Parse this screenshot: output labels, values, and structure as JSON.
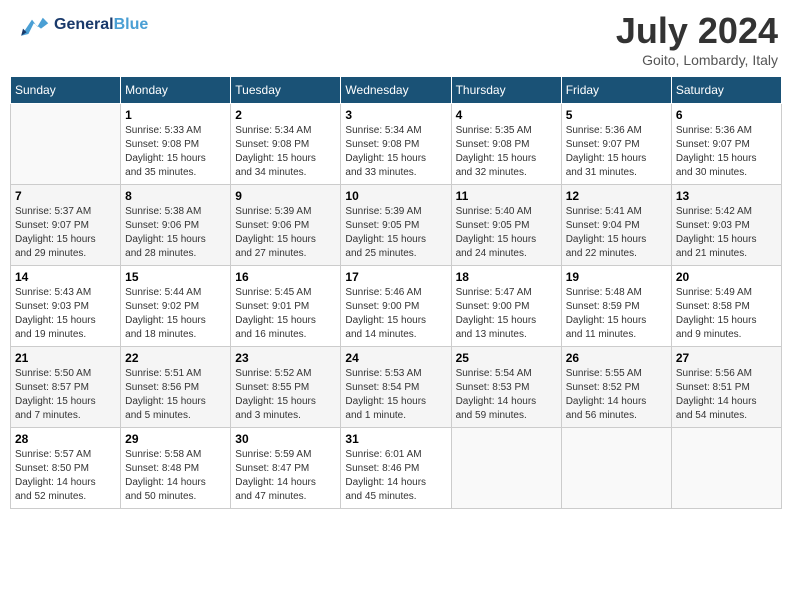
{
  "header": {
    "logo_general": "General",
    "logo_blue": "Blue",
    "title": "July 2024",
    "subtitle": "Goito, Lombardy, Italy"
  },
  "columns": [
    "Sunday",
    "Monday",
    "Tuesday",
    "Wednesday",
    "Thursday",
    "Friday",
    "Saturday"
  ],
  "weeks": [
    [
      {
        "day": "",
        "info": ""
      },
      {
        "day": "1",
        "info": "Sunrise: 5:33 AM\nSunset: 9:08 PM\nDaylight: 15 hours\nand 35 minutes."
      },
      {
        "day": "2",
        "info": "Sunrise: 5:34 AM\nSunset: 9:08 PM\nDaylight: 15 hours\nand 34 minutes."
      },
      {
        "day": "3",
        "info": "Sunrise: 5:34 AM\nSunset: 9:08 PM\nDaylight: 15 hours\nand 33 minutes."
      },
      {
        "day": "4",
        "info": "Sunrise: 5:35 AM\nSunset: 9:08 PM\nDaylight: 15 hours\nand 32 minutes."
      },
      {
        "day": "5",
        "info": "Sunrise: 5:36 AM\nSunset: 9:07 PM\nDaylight: 15 hours\nand 31 minutes."
      },
      {
        "day": "6",
        "info": "Sunrise: 5:36 AM\nSunset: 9:07 PM\nDaylight: 15 hours\nand 30 minutes."
      }
    ],
    [
      {
        "day": "7",
        "info": "Sunrise: 5:37 AM\nSunset: 9:07 PM\nDaylight: 15 hours\nand 29 minutes."
      },
      {
        "day": "8",
        "info": "Sunrise: 5:38 AM\nSunset: 9:06 PM\nDaylight: 15 hours\nand 28 minutes."
      },
      {
        "day": "9",
        "info": "Sunrise: 5:39 AM\nSunset: 9:06 PM\nDaylight: 15 hours\nand 27 minutes."
      },
      {
        "day": "10",
        "info": "Sunrise: 5:39 AM\nSunset: 9:05 PM\nDaylight: 15 hours\nand 25 minutes."
      },
      {
        "day": "11",
        "info": "Sunrise: 5:40 AM\nSunset: 9:05 PM\nDaylight: 15 hours\nand 24 minutes."
      },
      {
        "day": "12",
        "info": "Sunrise: 5:41 AM\nSunset: 9:04 PM\nDaylight: 15 hours\nand 22 minutes."
      },
      {
        "day": "13",
        "info": "Sunrise: 5:42 AM\nSunset: 9:03 PM\nDaylight: 15 hours\nand 21 minutes."
      }
    ],
    [
      {
        "day": "14",
        "info": "Sunrise: 5:43 AM\nSunset: 9:03 PM\nDaylight: 15 hours\nand 19 minutes."
      },
      {
        "day": "15",
        "info": "Sunrise: 5:44 AM\nSunset: 9:02 PM\nDaylight: 15 hours\nand 18 minutes."
      },
      {
        "day": "16",
        "info": "Sunrise: 5:45 AM\nSunset: 9:01 PM\nDaylight: 15 hours\nand 16 minutes."
      },
      {
        "day": "17",
        "info": "Sunrise: 5:46 AM\nSunset: 9:00 PM\nDaylight: 15 hours\nand 14 minutes."
      },
      {
        "day": "18",
        "info": "Sunrise: 5:47 AM\nSunset: 9:00 PM\nDaylight: 15 hours\nand 13 minutes."
      },
      {
        "day": "19",
        "info": "Sunrise: 5:48 AM\nSunset: 8:59 PM\nDaylight: 15 hours\nand 11 minutes."
      },
      {
        "day": "20",
        "info": "Sunrise: 5:49 AM\nSunset: 8:58 PM\nDaylight: 15 hours\nand 9 minutes."
      }
    ],
    [
      {
        "day": "21",
        "info": "Sunrise: 5:50 AM\nSunset: 8:57 PM\nDaylight: 15 hours\nand 7 minutes."
      },
      {
        "day": "22",
        "info": "Sunrise: 5:51 AM\nSunset: 8:56 PM\nDaylight: 15 hours\nand 5 minutes."
      },
      {
        "day": "23",
        "info": "Sunrise: 5:52 AM\nSunset: 8:55 PM\nDaylight: 15 hours\nand 3 minutes."
      },
      {
        "day": "24",
        "info": "Sunrise: 5:53 AM\nSunset: 8:54 PM\nDaylight: 15 hours\nand 1 minute."
      },
      {
        "day": "25",
        "info": "Sunrise: 5:54 AM\nSunset: 8:53 PM\nDaylight: 14 hours\nand 59 minutes."
      },
      {
        "day": "26",
        "info": "Sunrise: 5:55 AM\nSunset: 8:52 PM\nDaylight: 14 hours\nand 56 minutes."
      },
      {
        "day": "27",
        "info": "Sunrise: 5:56 AM\nSunset: 8:51 PM\nDaylight: 14 hours\nand 54 minutes."
      }
    ],
    [
      {
        "day": "28",
        "info": "Sunrise: 5:57 AM\nSunset: 8:50 PM\nDaylight: 14 hours\nand 52 minutes."
      },
      {
        "day": "29",
        "info": "Sunrise: 5:58 AM\nSunset: 8:48 PM\nDaylight: 14 hours\nand 50 minutes."
      },
      {
        "day": "30",
        "info": "Sunrise: 5:59 AM\nSunset: 8:47 PM\nDaylight: 14 hours\nand 47 minutes."
      },
      {
        "day": "31",
        "info": "Sunrise: 6:01 AM\nSunset: 8:46 PM\nDaylight: 14 hours\nand 45 minutes."
      },
      {
        "day": "",
        "info": ""
      },
      {
        "day": "",
        "info": ""
      },
      {
        "day": "",
        "info": ""
      }
    ]
  ]
}
